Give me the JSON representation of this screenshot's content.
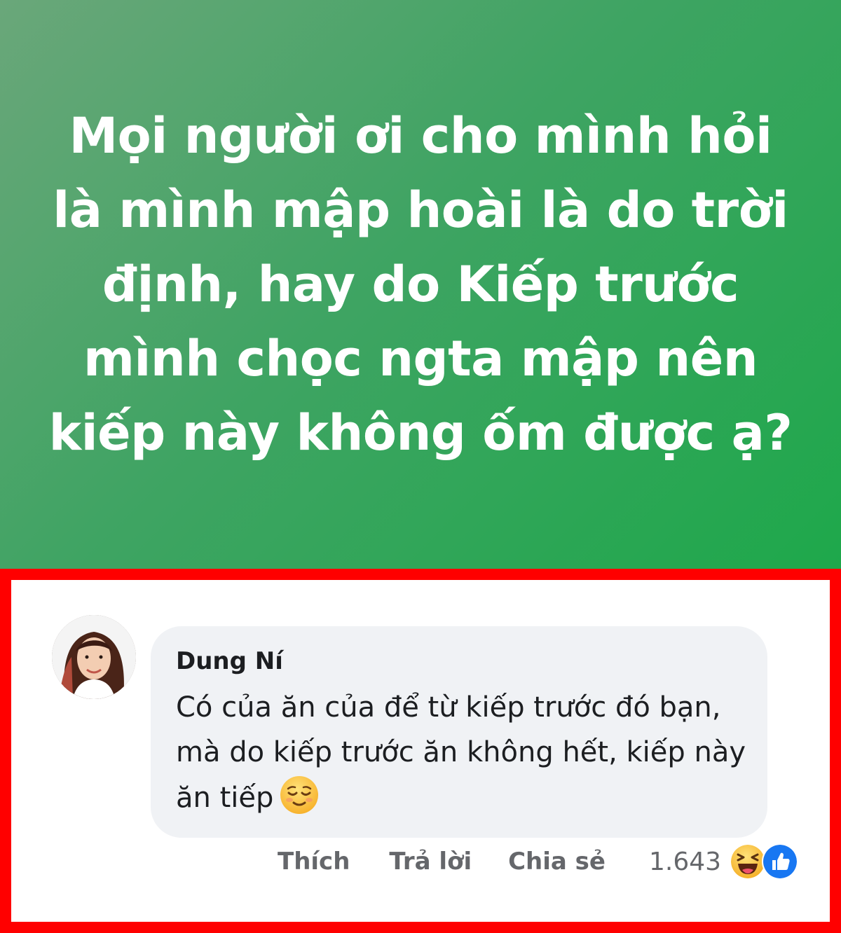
{
  "post": {
    "text": "Mọi người ơi cho mình hỏi là mình mập hoài là do trời định, hay do Kiếp trước mình chọc ngta mập nên kiếp này không ốm được ạ?",
    "background_colors": [
      "#6aa77a",
      "#1ea84b"
    ]
  },
  "comment": {
    "author": "Dung Ní",
    "text": "Có của ăn của để từ kiếp trước đó bạn, mà do kiếp trước ăn không hết, kiếp này ăn tiếp",
    "emoji": "relieved-face-icon",
    "highlight_border_color": "#ff0000"
  },
  "actions": {
    "like_label": "Thích",
    "reply_label": "Trả lời",
    "share_label": "Chia sẻ",
    "reaction_count": "1.643",
    "reaction_icons": [
      "haha-icon",
      "like-icon"
    ]
  }
}
